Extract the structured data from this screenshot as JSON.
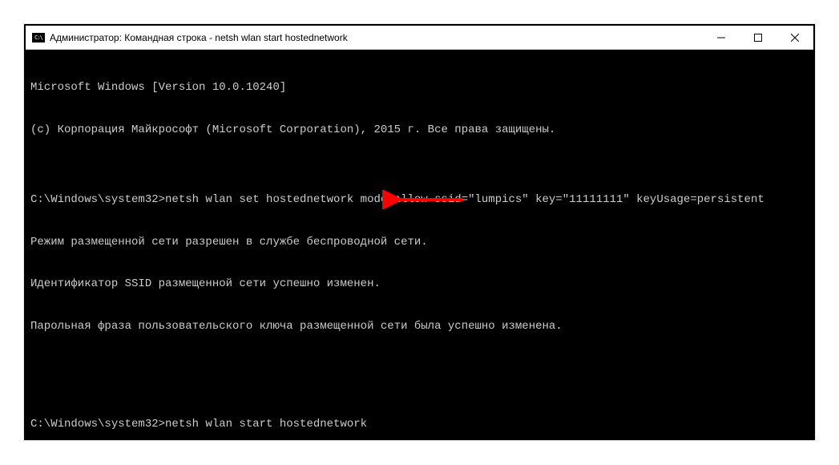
{
  "window": {
    "title": "Администратор: Командная строка - netsh  wlan start hostednetwork"
  },
  "terminal": {
    "lines": [
      "Microsoft Windows [Version 10.0.10240]",
      "(c) Корпорация Майкрософт (Microsoft Corporation), 2015 г. Все права защищены.",
      "",
      "C:\\Windows\\system32>netsh wlan set hostednetwork mode=allow ssid=\"lumpics\" key=\"11111111\" keyUsage=persistent",
      "Режим размещенной сети разрешен в службе беспроводной сети.",
      "Идентификатор SSID размещенной сети успешно изменен.",
      "Парольная фраза пользовательского ключа размещенной сети была успешно изменена.",
      "",
      "",
      "C:\\Windows\\system32>netsh wlan start hostednetwork"
    ]
  }
}
